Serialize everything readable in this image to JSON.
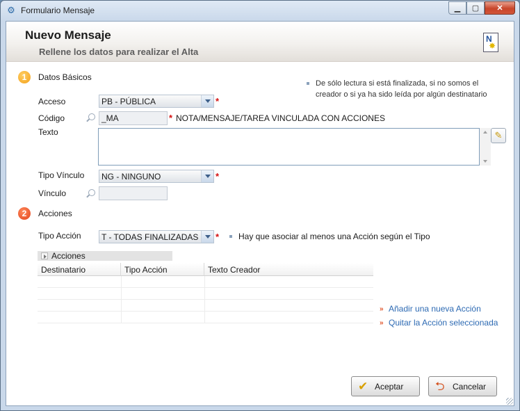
{
  "window": {
    "title": "Formulario Mensaje",
    "minimize": "▁",
    "maximize": "▢",
    "close": "✕"
  },
  "header": {
    "title": "Nuevo Mensaje",
    "subtitle": "Rellene los datos para realizar el Alta"
  },
  "section1": {
    "number": "1",
    "label": "Datos Básicos",
    "note": "De sólo lectura si está finalizada, si no somos el creador o si ya ha sido leída por algún destinatario"
  },
  "fields": {
    "acceso": {
      "label": "Acceso",
      "value": "PB - PÚBLICA",
      "required": "*"
    },
    "codigo": {
      "label": "Código",
      "value": "_MA",
      "required": "*",
      "note": "NOTA/MENSAJE/TAREA VINCULADA CON ACCIONES"
    },
    "texto": {
      "label": "Texto",
      "value": ""
    },
    "tipo_vinculo": {
      "label": "Tipo Vínculo",
      "value": "NG - NINGUNO",
      "required": "*"
    },
    "vinculo": {
      "label": "Vínculo",
      "value": ""
    }
  },
  "section2": {
    "number": "2",
    "label": "Acciones",
    "tipo_accion": {
      "label": "Tipo Acción",
      "value": "T - TODAS FINALIZADAS",
      "required": "*",
      "note": "Hay que asociar al menos una Acción según el Tipo"
    }
  },
  "grid": {
    "title": "Acciones",
    "columns": [
      "Destinatario",
      "Tipo Acción",
      "Texto Creador"
    ]
  },
  "actions": {
    "add": "Añadir una nueva Acción",
    "remove": "Quitar la Acción seleccionada"
  },
  "buttons": {
    "accept": "Aceptar",
    "cancel": "Cancelar"
  },
  "icons": {
    "app": "settings-icon",
    "edit": "pencil-icon",
    "doc": "new-document-icon",
    "accept": "checkmark-icon",
    "cancel": "cancel-arrow-icon"
  },
  "colors": {
    "required": "#d41010",
    "link": "#2d6ab3",
    "section1": "#f3a018",
    "section2": "#e2421a"
  }
}
